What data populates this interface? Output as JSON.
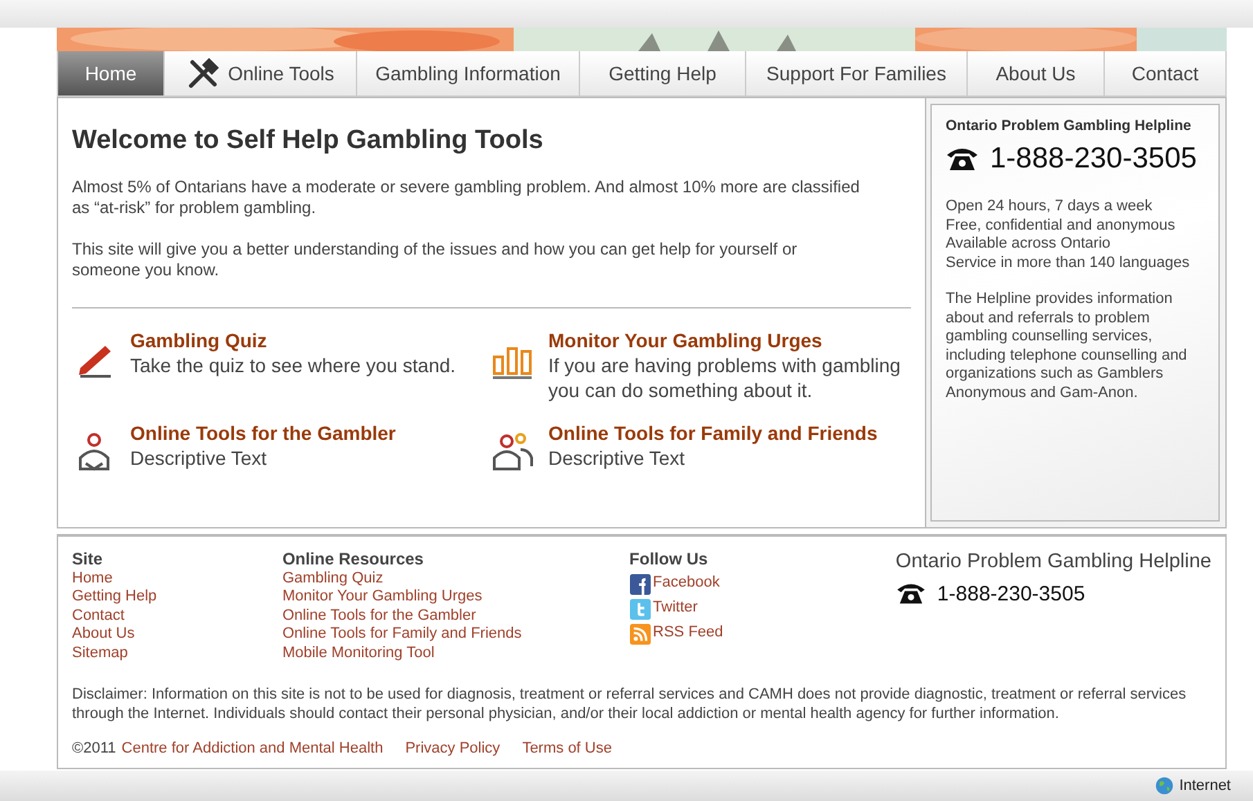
{
  "nav": [
    {
      "label": "Home",
      "selected": true,
      "icon": false
    },
    {
      "label": "Online Tools",
      "selected": false,
      "icon": true
    },
    {
      "label": "Gambling Information",
      "selected": false,
      "icon": false
    },
    {
      "label": "Getting Help",
      "selected": false,
      "icon": false
    },
    {
      "label": "Support For Families",
      "selected": false,
      "icon": false
    },
    {
      "label": "About Us",
      "selected": false,
      "icon": false
    },
    {
      "label": "Contact",
      "selected": false,
      "icon": false
    }
  ],
  "main": {
    "title": "Welcome to Self Help Gambling Tools",
    "paragraphs": [
      "Almost 5% of Ontarians have a moderate or severe gambling problem. And almost 10% more are classified as “at-risk” for problem gambling.",
      "This site will give you a better understanding of the issues and how you can get help for yourself or someone you know."
    ],
    "tools": [
      {
        "kind": "pencil",
        "title": "Gambling Quiz",
        "text": "Take the quiz to see where you stand."
      },
      {
        "kind": "bars",
        "title": "Monitor Your Gambling Urges",
        "text": "If you are having problems with gambling you can do something about it."
      },
      {
        "kind": "person",
        "title": "Online Tools for the Gambler",
        "text": "Descriptive Text"
      },
      {
        "kind": "people",
        "title": "Online Tools for Family and Friends",
        "text": "Descriptive Text"
      }
    ]
  },
  "helpline": {
    "title": "Ontario Problem Gambling Helpline",
    "phone": "1-888-230-3505",
    "lines": [
      "Open 24 hours, 7 days a week",
      "Free, confidential and anonymous",
      "Available across Ontario",
      "Service in more than 140 languages"
    ],
    "description": "The Helpline provides information about and referrals to problem gambling counselling services, including telephone counselling and organizations such as Gamblers Anonymous and Gam-Anon."
  },
  "footer": {
    "columns": [
      {
        "heading": "Site",
        "links": [
          "Home",
          "Getting Help",
          "Contact",
          "About Us",
          "Sitemap"
        ]
      },
      {
        "heading": "Online Resources",
        "links": [
          "Gambling Quiz",
          "Monitor Your Gambling Urges",
          "Online Tools for the Gambler",
          "Online Tools for Family and Friends",
          "Mobile Monitoring Tool"
        ]
      }
    ],
    "follow": {
      "heading": "Follow Us",
      "links": [
        {
          "kind": "facebook",
          "label": "Facebook"
        },
        {
          "kind": "twitter",
          "label": "Twitter"
        },
        {
          "kind": "rss",
          "label": "RSS Feed"
        }
      ]
    },
    "helpline": {
      "title": "Ontario Problem Gambling Helpline",
      "phone": "1-888-230-3505"
    },
    "disclaimer": "Disclaimer: Information on this site is not to be used for diagnosis, treatment or referral services and CAMH does not provide diagnostic, treatment or referral services through the Internet. Individuals should contact their personal physician, and/or their local addiction or mental health agency for further information.",
    "copyright": "©2011",
    "bottom_links": [
      "Centre for Addiction and Mental Health",
      "Privacy Policy",
      "Terms of Use"
    ]
  },
  "status_bar": {
    "zone": "Internet"
  }
}
